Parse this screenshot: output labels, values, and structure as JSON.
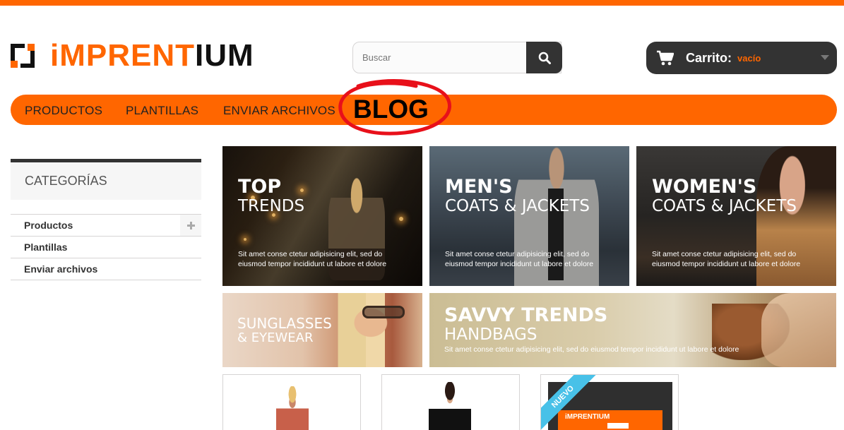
{
  "brand": {
    "logo_part1": "iMPRENT",
    "logo_part2": "IUM",
    "accent": "#ff6600",
    "dark": "#333333"
  },
  "search": {
    "placeholder": "Buscar",
    "icon": "search-icon"
  },
  "cart": {
    "label": "Carrito:",
    "status": "vacío",
    "icon": "shopping-cart-icon"
  },
  "nav": {
    "items": [
      {
        "label": "PRODUCTOS"
      },
      {
        "label": "PLANTILLAS"
      },
      {
        "label": "ENVIAR ARCHIVOS"
      },
      {
        "label": "BLOG"
      }
    ],
    "highlight_color": "#e8101a"
  },
  "sidebar": {
    "title": "CATEGORÍAS",
    "items": [
      {
        "label": "Productos",
        "expandable": true
      },
      {
        "label": "Plantillas"
      },
      {
        "label": "Enviar archivos"
      }
    ]
  },
  "banners": [
    {
      "line1": "TOP",
      "line2": "TRENDS",
      "desc": "Sit amet conse ctetur adipisicing elit, sed do eiusmod tempor incididunt ut labore et dolore"
    },
    {
      "line1": "MEN'S",
      "line2": "COATS & JACKETS",
      "desc": "Sit amet conse ctetur adipisicing elit, sed do eiusmod tempor incididunt ut labore et dolore"
    },
    {
      "line1": "WOMEN'S",
      "line2": "COATS & JACKETS",
      "desc": "Sit amet conse ctetur adipisicing elit, sed do eiusmod tempor incididunt ut labore et dolore"
    },
    {
      "line1": "SUNGLASSES",
      "line2": "& EYEWEAR"
    },
    {
      "line1": "SAVVY TRENDS",
      "line2": "HANDBAGS",
      "desc": "Sit amet conse ctetur adipisicing elit, sed do eiusmod tempor incididunt ut labore et dolore"
    }
  ],
  "products": [
    {
      "image": "woman-straw-hat-photo"
    },
    {
      "image": "woman-black-dress-photo"
    },
    {
      "badge": "NUEVO",
      "image_text": "iMPRENTIUM"
    }
  ]
}
